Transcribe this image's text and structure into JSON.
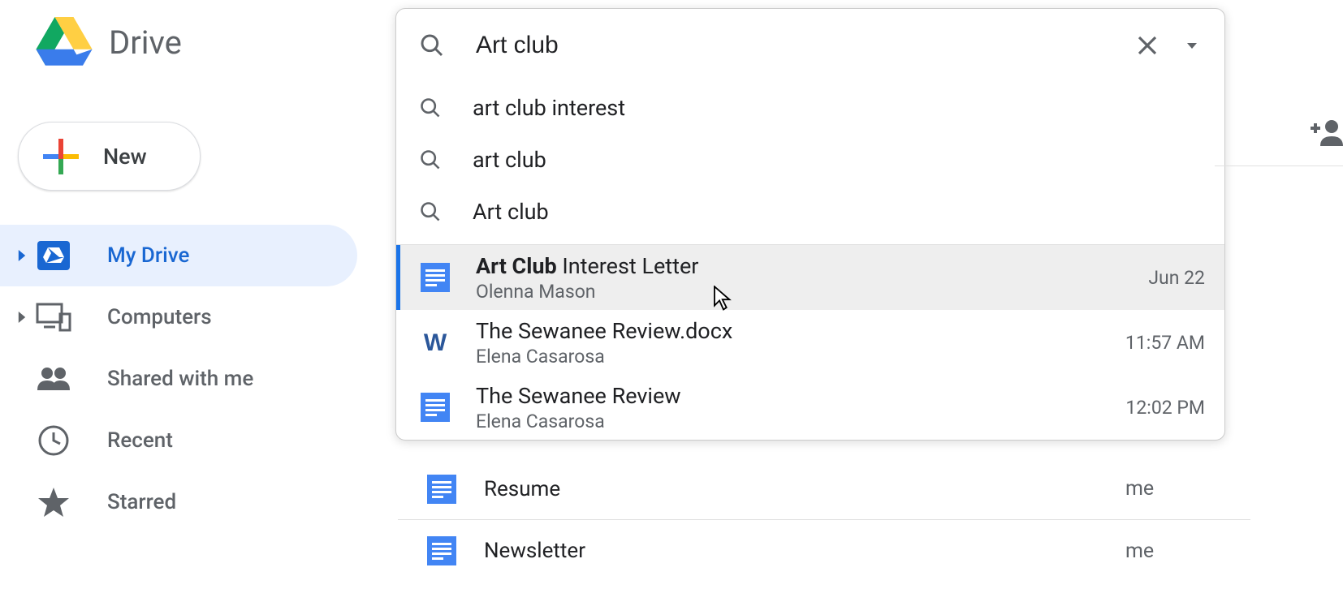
{
  "app": {
    "title": "Drive"
  },
  "new_button": {
    "label": "New"
  },
  "sidebar": {
    "items": [
      {
        "label": "My Drive",
        "active": true,
        "expandable": true
      },
      {
        "label": "Computers",
        "active": false,
        "expandable": true
      },
      {
        "label": "Shared with me",
        "active": false,
        "expandable": false
      },
      {
        "label": "Recent",
        "active": false,
        "expandable": false
      },
      {
        "label": "Starred",
        "active": false,
        "expandable": false
      }
    ]
  },
  "search": {
    "value": "Art club",
    "suggestions": [
      "art club interest",
      "art club",
      "Art club"
    ],
    "results": [
      {
        "title_bold": "Art Club",
        "title_rest": " Interest Letter",
        "owner": "Olenna Mason",
        "meta": "Jun 22",
        "type": "doc",
        "highlight": true
      },
      {
        "title_bold": "",
        "title_rest": "The Sewanee Review.docx",
        "owner": "Elena Casarosa",
        "meta": "11:57 AM",
        "type": "word",
        "highlight": false
      },
      {
        "title_bold": "",
        "title_rest": "The Sewanee Review",
        "owner": "Elena Casarosa",
        "meta": "12:02 PM",
        "type": "doc",
        "highlight": false
      }
    ]
  },
  "bg_files": [
    {
      "title": "Resume",
      "owner": "me",
      "type": "doc"
    },
    {
      "title": "Newsletter",
      "owner": "me",
      "type": "doc"
    }
  ]
}
